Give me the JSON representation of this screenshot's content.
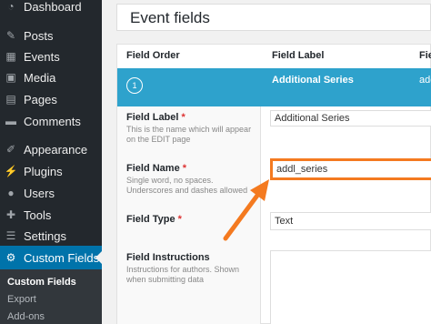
{
  "sidebar": {
    "items": [
      {
        "label": "Dashboard",
        "icon": "dashboard-icon",
        "glyph": "◔"
      },
      {
        "label": "Posts",
        "icon": "pin-icon",
        "glyph": "✎"
      },
      {
        "label": "Events",
        "icon": "calendar-icon",
        "glyph": "▦"
      },
      {
        "label": "Media",
        "icon": "media-icon",
        "glyph": "▣"
      },
      {
        "label": "Pages",
        "icon": "page-icon",
        "glyph": "▤"
      },
      {
        "label": "Comments",
        "icon": "comment-icon",
        "glyph": "▬"
      },
      {
        "label": "Appearance",
        "icon": "brush-icon",
        "glyph": "✐"
      },
      {
        "label": "Plugins",
        "icon": "plugin-icon",
        "glyph": "⚡"
      },
      {
        "label": "Users",
        "icon": "user-icon",
        "glyph": "●"
      },
      {
        "label": "Tools",
        "icon": "wrench-icon",
        "glyph": "✚"
      },
      {
        "label": "Settings",
        "icon": "settings-icon",
        "glyph": "☰"
      },
      {
        "label": "Custom Fields",
        "icon": "gear-icon",
        "glyph": "⚙"
      }
    ],
    "submenu": [
      "Custom Fields",
      "Export",
      "Add-ons"
    ]
  },
  "page": {
    "title": "Event fields"
  },
  "table": {
    "headers": [
      "Field Order",
      "Field Label",
      "Field"
    ],
    "row": {
      "order": "1",
      "label": "Additional Series",
      "name": "add"
    }
  },
  "settings": {
    "field_label": {
      "title": "Field Label",
      "required": "*",
      "desc": "This is the name which will appear on the EDIT page",
      "value": "Additional Series"
    },
    "field_name": {
      "title": "Field Name",
      "required": "*",
      "desc": "Single word, no spaces. Underscores and dashes allowed",
      "value": "addl_series"
    },
    "field_type": {
      "title": "Field Type",
      "required": "*",
      "value": "Text"
    },
    "field_instructions": {
      "title": "Field Instructions",
      "desc": "Instructions for authors. Shown when submitting data",
      "value": ""
    }
  },
  "colors": {
    "sidebar_bg": "#23282d",
    "active_bg": "#0073aa",
    "row_bg": "#2ea2cc",
    "highlight": "#f47a20"
  }
}
